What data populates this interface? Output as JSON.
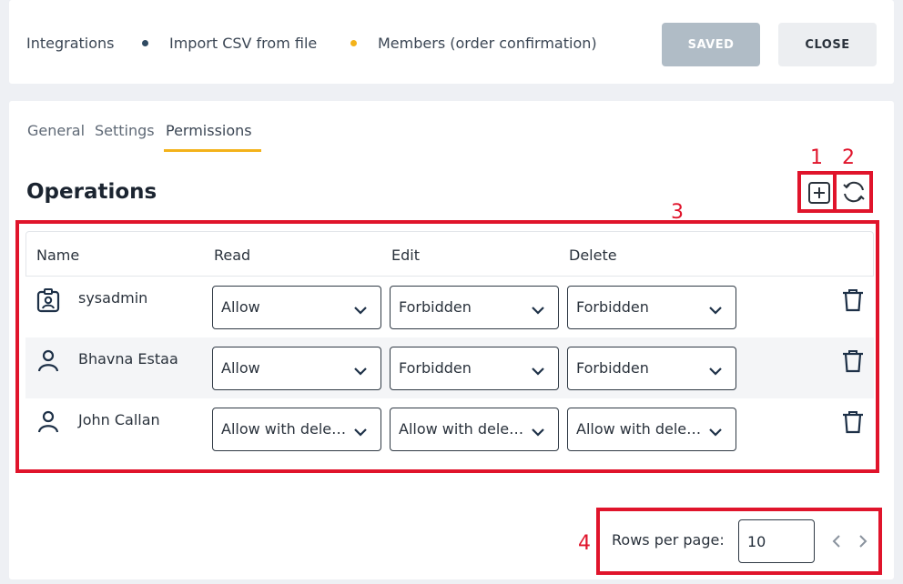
{
  "breadcrumb": {
    "items": [
      "Integrations",
      "Import CSV from file",
      "Members (order confirmation)"
    ],
    "dot_colors": [
      "#2f4a62",
      "#f3b21a"
    ]
  },
  "toolbar": {
    "saved_label": "SAVED",
    "close_label": "CLOSE"
  },
  "tabs": [
    {
      "label": "General",
      "active": false
    },
    {
      "label": "Settings",
      "active": false
    },
    {
      "label": "Permissions",
      "active": true
    }
  ],
  "section": {
    "title": "Operations",
    "add_icon": "plus-square-icon",
    "refresh_icon": "refresh-icon"
  },
  "table": {
    "headers": [
      "Name",
      "Read",
      "Edit",
      "Delete"
    ],
    "rows": [
      {
        "name": "sysadmin",
        "icon": "id-badge-icon",
        "read": "Allow",
        "edit": "Forbidden",
        "delete": "Forbidden"
      },
      {
        "name": "Bhavna Estaa",
        "icon": "user-icon",
        "read": "Allow",
        "edit": "Forbidden",
        "delete": "Forbidden"
      },
      {
        "name": "John Callan",
        "icon": "user-icon",
        "read": "Allow with delegation",
        "edit": "Allow with delegation",
        "delete": "Allow with delegation"
      }
    ]
  },
  "pagination": {
    "rows_per_page_label": "Rows per page:",
    "rows_per_page_value": "10"
  },
  "annotations": [
    "1",
    "2",
    "3",
    "4"
  ],
  "colors": {
    "accent": "#f3b21a",
    "annotation": "#e0142b",
    "saved_button": "#b0bcc6"
  }
}
